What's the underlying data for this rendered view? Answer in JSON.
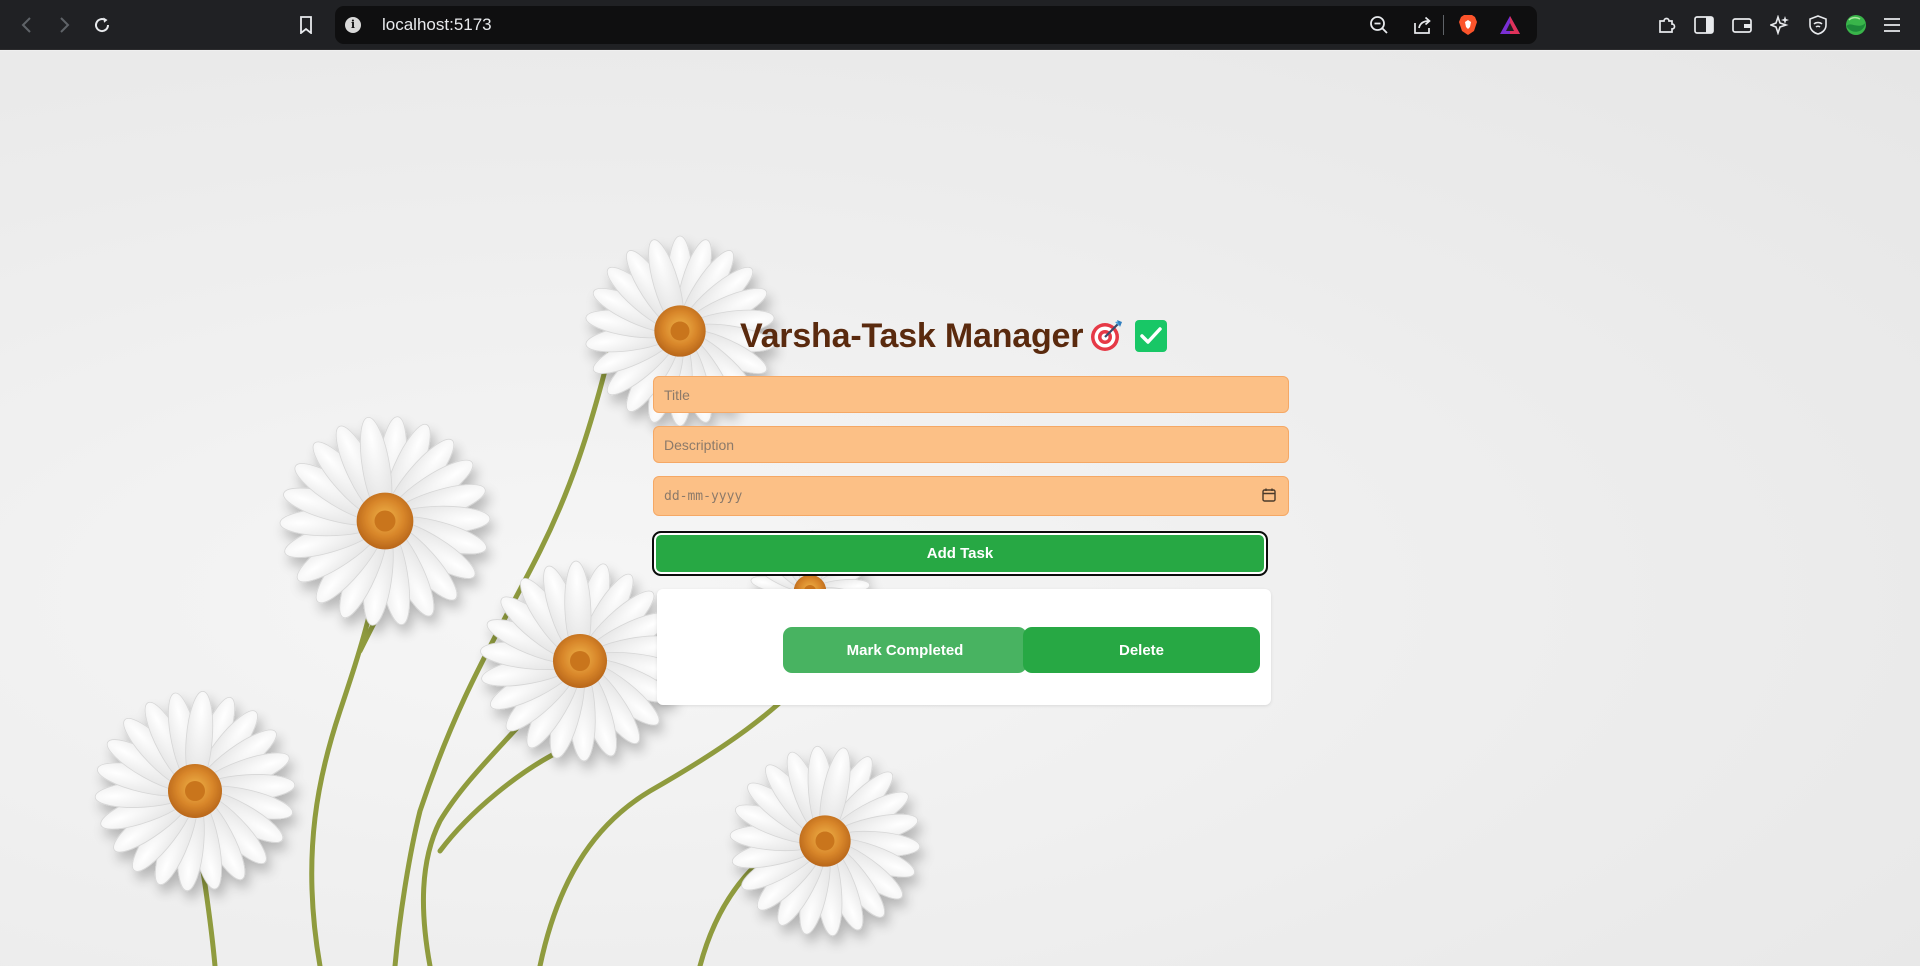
{
  "browser": {
    "url": "localhost:5173",
    "icons": [
      "back-icon",
      "forward-icon",
      "reload-icon",
      "bookmark-icon",
      "site-info-icon",
      "zoom-out-icon",
      "share-icon",
      "brave-shields-icon",
      "brave-rewards-icon",
      "extensions-icon",
      "sidebar-icon",
      "wallet-icon",
      "leo-ai-icon",
      "vpn-icon",
      "profile-icon",
      "menu-icon"
    ]
  },
  "app": {
    "title": "Varsha-Task Manager",
    "title_color": "#5a2a0e",
    "field_color": "#fcc086",
    "accent_color": "#27a844",
    "form": {
      "title_placeholder": "Title",
      "description_placeholder": "Description",
      "date_placeholder": "dd-mm-yyyy",
      "add_label": "Add Task"
    },
    "task": {
      "mark_label": "Mark Completed",
      "delete_label": "Delete"
    }
  }
}
